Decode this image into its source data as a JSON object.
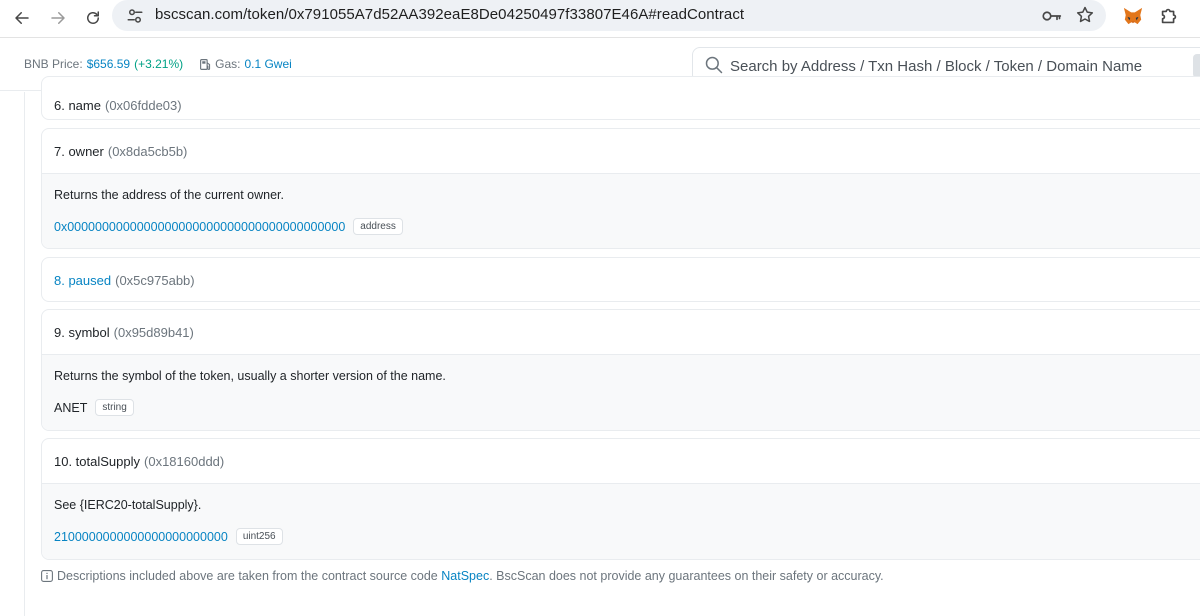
{
  "browser": {
    "url": "bscscan.com/token/0x791055A7d52AA392eaE8De04250497f33807E46A#readContract"
  },
  "header": {
    "bnb_label": "BNB Price:",
    "bnb_price": "$656.59",
    "bnb_change": "(+3.21%)",
    "gas_label": "Gas:",
    "gas_value": "0.1 Gwei",
    "search_placeholder": "Search by Address / Txn Hash / Block / Token / Domain Name"
  },
  "functions": [
    {
      "name": "6. name",
      "selector": "(0x06fdde03)"
    },
    {
      "name": "7. owner",
      "selector": "(0x8da5cb5b)",
      "description": "Returns the address of the current owner.",
      "result": "0x0000000000000000000000000000000000000000",
      "type": "address"
    },
    {
      "name": "8. paused",
      "selector": "(0x5c975abb)"
    },
    {
      "name": "9. symbol",
      "selector": "(0x95d89b41)",
      "description": "Returns the symbol of the token, usually a shorter version of the name.",
      "result": "ANET",
      "type": "string"
    },
    {
      "name": "10. totalSupply",
      "selector": "(0x18160ddd)",
      "description": "See {IERC20-totalSupply}.",
      "result": "2100000000000000000000000",
      "type": "uint256"
    }
  ],
  "footnote": {
    "prefix": "Descriptions included above are taken from the contract source code",
    "link": "NatSpec",
    "suffix": ". BscScan does not provide any guarantees on their safety or accuracy."
  },
  "colors": {
    "link": "#0784c3",
    "positive": "#00a186",
    "muted": "#6c757d"
  }
}
